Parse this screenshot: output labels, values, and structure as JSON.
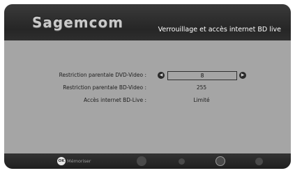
{
  "header": {
    "brand": "Sagemcom",
    "title": "Verrouillage et accès internet BD live"
  },
  "settings": [
    {
      "label": "Restriction parentale DVD-Video :",
      "value": "8"
    },
    {
      "label": "Restriction parentale BD-Video :",
      "value": "255"
    },
    {
      "label": "Accès internet BD-Live :",
      "value": "Limité"
    }
  ],
  "footer": {
    "ok_icon_text": "OK",
    "ok_label": "Mémoriser"
  }
}
